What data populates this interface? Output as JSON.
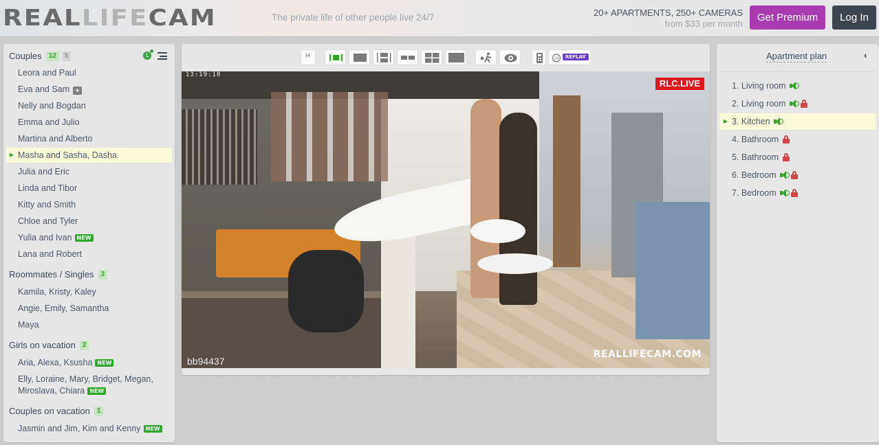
{
  "header": {
    "logo": {
      "part1": "REAL",
      "part2": "LIFE",
      "part3": "CAM"
    },
    "tagline": "The private life of other people live 24/7",
    "promo_line1": "20+ APARTMENTS, 250+ CAMERAS",
    "promo_line2": "from $33 per month",
    "premium_button": "Get Premium",
    "login_button": "Log In",
    "colors": {
      "premium": "#a93cb0",
      "login": "#3d4650"
    }
  },
  "sidebar": {
    "groups": [
      {
        "title": "Couples",
        "count": "12",
        "extra_count": "5",
        "items": [
          {
            "label": "Leora and Paul"
          },
          {
            "label": "Eva and Sam",
            "icon": "airplane-icon"
          },
          {
            "label": "Nelly and Bogdan"
          },
          {
            "label": "Emma and Julio"
          },
          {
            "label": "Martina and Alberto"
          },
          {
            "label": "Masha and Sasha, Dasha",
            "active": true
          },
          {
            "label": "Julia and Eric"
          },
          {
            "label": "Linda and Tibor"
          },
          {
            "label": "Kitty and Smith"
          },
          {
            "label": "Chloe and Tyler"
          },
          {
            "label": "Yulia and Ivan",
            "badge": "NEW"
          },
          {
            "label": "Lana and Robert"
          }
        ]
      },
      {
        "title": "Roommates / Singles",
        "count": "3",
        "items": [
          {
            "label": "Kamila, Kristy, Kaley"
          },
          {
            "label": "Angie, Emily, Samantha"
          },
          {
            "label": "Maya"
          }
        ]
      },
      {
        "title": "Girls on vacation",
        "count": "2",
        "items": [
          {
            "label": "Aria, Alexa, Ksusha",
            "badge": "NEW"
          },
          {
            "label": "Elly, Loraine, Mary, Bridget, Megan, Miroslava, Chiara",
            "badge": "NEW"
          }
        ]
      },
      {
        "title": "Couples on vacation",
        "count": "1",
        "items": [
          {
            "label": "Jasmin and Jim, Kim and Kenny",
            "badge": "NEW"
          }
        ]
      }
    ],
    "new_badge": "NEW"
  },
  "toolbar": {
    "buttons": [
      {
        "name": "hd-toggle",
        "label": "H"
      },
      {
        "name": "layout-single-small",
        "active": true
      },
      {
        "name": "layout-single"
      },
      {
        "name": "layout-vertical-split"
      },
      {
        "name": "layout-two"
      },
      {
        "name": "layout-four"
      },
      {
        "name": "layout-fullwidth"
      },
      {
        "name": "motion-detect"
      },
      {
        "name": "view-eye"
      },
      {
        "name": "mobile"
      },
      {
        "name": "replay",
        "label": "REPLAY"
      }
    ],
    "replay_icon_text": "24",
    "colors": {
      "active": "#2ca82a",
      "replay": "#6b3fc8"
    }
  },
  "video": {
    "timestamp": "13:19:18",
    "live_badge": "RLC.LIVE",
    "camera_id": "bb94437",
    "watermark": "REALLIFECAM.COM",
    "colors": {
      "live": "#e0161c"
    }
  },
  "apartment_plan": {
    "title": "Apartment plan",
    "collapse_icon": "‹",
    "rooms": [
      {
        "label": "1. Living room",
        "sound": true,
        "locked": false
      },
      {
        "label": "2. Living room",
        "sound": true,
        "locked": true
      },
      {
        "label": "3. Kitchen",
        "sound": true,
        "locked": false,
        "active": true
      },
      {
        "label": "4. Bathroom",
        "sound": false,
        "locked": true
      },
      {
        "label": "5. Bathroom",
        "sound": false,
        "locked": true
      },
      {
        "label": "6. Bedroom",
        "sound": true,
        "locked": true
      },
      {
        "label": "7. Bedroom",
        "sound": true,
        "locked": true
      }
    ]
  }
}
